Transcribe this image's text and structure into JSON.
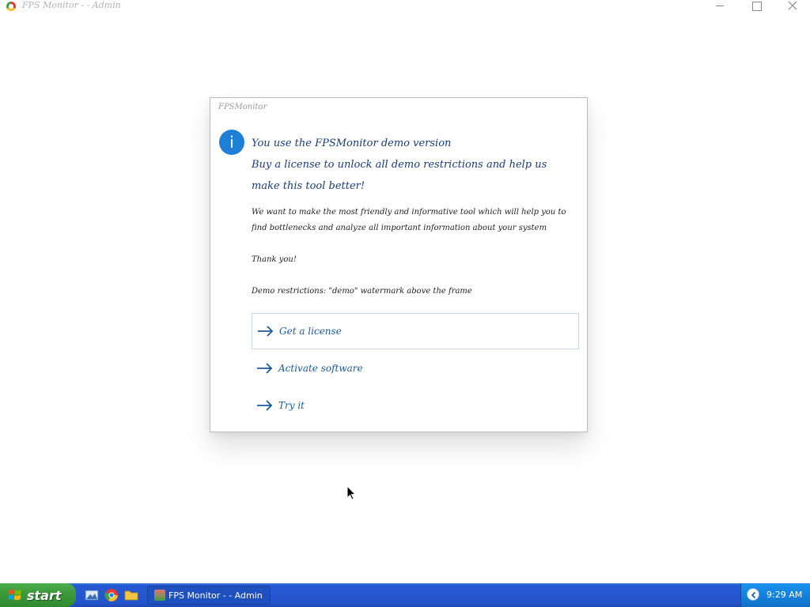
{
  "window": {
    "title": "FPS Monitor  -   - Admin",
    "minimize_label": "",
    "maximize_label": "",
    "close_label": ""
  },
  "dialog": {
    "caption": "FPSMonitor",
    "heading_line1": "You use the FPSMonitor demo version",
    "heading_line2": "Buy a license to unlock all demo restrictions and help us",
    "heading_line3": "make this tool better!",
    "paragraph1": "We want to make the most friendly and informative tool which will help you to find bottlenecks and analyze all important information about your system",
    "paragraph2": "Thank you!",
    "paragraph3": "Demo restrictions: \"demo\" watermark above the frame",
    "commands": [
      {
        "label": "Get a license"
      },
      {
        "label": "Activate software"
      },
      {
        "label": "Try it"
      }
    ]
  },
  "taskbar": {
    "start_label": "start",
    "task_label": "FPS Monitor -  - Admin",
    "clock": "9:29 AM"
  },
  "colors": {
    "accent": "#1e7fd6",
    "taskbar": "#2555cd",
    "start": "#3c9a3c"
  }
}
